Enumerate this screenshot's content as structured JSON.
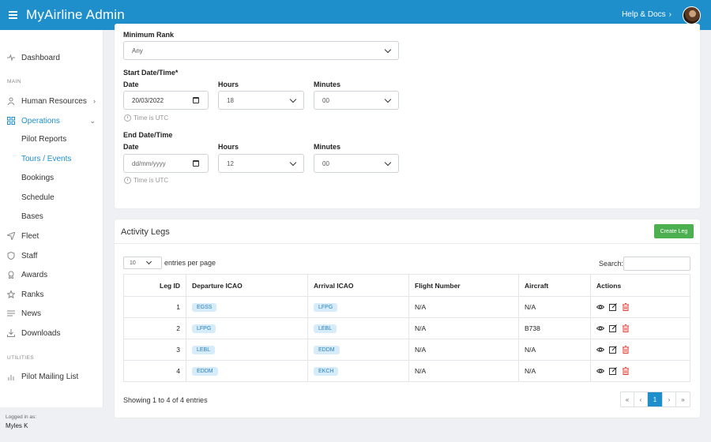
{
  "header": {
    "app_title": "MyAirline Admin",
    "help_label": "Help & Docs",
    "help_chevron": "›"
  },
  "sidebar": {
    "dashboard": "Dashboard",
    "section_main": "MAIN",
    "human_resources": "Human Resources",
    "operations": "Operations",
    "operations_sub": [
      "Pilot Reports",
      "Tours / Events",
      "Bookings",
      "Schedule",
      "Bases"
    ],
    "fleet": "Fleet",
    "staff": "Staff",
    "awards": "Awards",
    "ranks": "Ranks",
    "news": "News",
    "downloads": "Downloads",
    "section_utilities": "UTILITIES",
    "pilot_mailing_list": "Pilot Mailing List",
    "footer_logged_in": "Logged in as:",
    "footer_user": "Myles K",
    "active_item": "Tours / Events"
  },
  "form": {
    "min_rank_label": "Minimum Rank",
    "min_rank_value": "Any",
    "start_section": "Start Date/Time*",
    "start_date_label": "Date",
    "start_date_value": "20/03/2022",
    "start_hours_label": "Hours",
    "start_hours_value": "18",
    "start_minutes_label": "Minutes",
    "start_minutes_value": "00",
    "start_hint": "Time is UTC",
    "end_section": "End Date/Time",
    "end_date_label": "Date",
    "end_date_value": "dd/mm/yyyy",
    "end_hours_label": "Hours",
    "end_hours_value": "12",
    "end_minutes_label": "Minutes",
    "end_minutes_value": "00",
    "end_hint": "Time is UTC"
  },
  "legs": {
    "title": "Activity Legs",
    "create_button": "Create Leg",
    "entries_value": "10",
    "entries_label": "entries per page",
    "search_label": "Search:",
    "search_value": "",
    "columns": [
      "Leg ID",
      "Departure ICAO",
      "Arrival ICAO",
      "Flight Number",
      "Aircraft",
      "Actions"
    ],
    "rows": [
      {
        "id": "1",
        "dep": "EGSS",
        "arr": "LFPG",
        "flight": "N/A",
        "aircraft": "N/A"
      },
      {
        "id": "2",
        "dep": "LFPG",
        "arr": "LEBL",
        "flight": "N/A",
        "aircraft": "B738"
      },
      {
        "id": "3",
        "dep": "LEBL",
        "arr": "EDDM",
        "flight": "N/A",
        "aircraft": "N/A"
      },
      {
        "id": "4",
        "dep": "EDDM",
        "arr": "EKCH",
        "flight": "N/A",
        "aircraft": "N/A"
      }
    ],
    "showing": "Showing 1 to 4 of 4 entries",
    "pager": {
      "first": "«",
      "prev": "‹",
      "current": "1",
      "next": "›",
      "last": "»"
    }
  },
  "colors": {
    "primary": "#1f8fcc",
    "success": "#4caf50",
    "danger": "#e53935",
    "chip_bg": "#d6ecfa"
  },
  "icons": {
    "view": "eye-icon",
    "edit": "edit-icon",
    "delete": "trash-icon"
  }
}
